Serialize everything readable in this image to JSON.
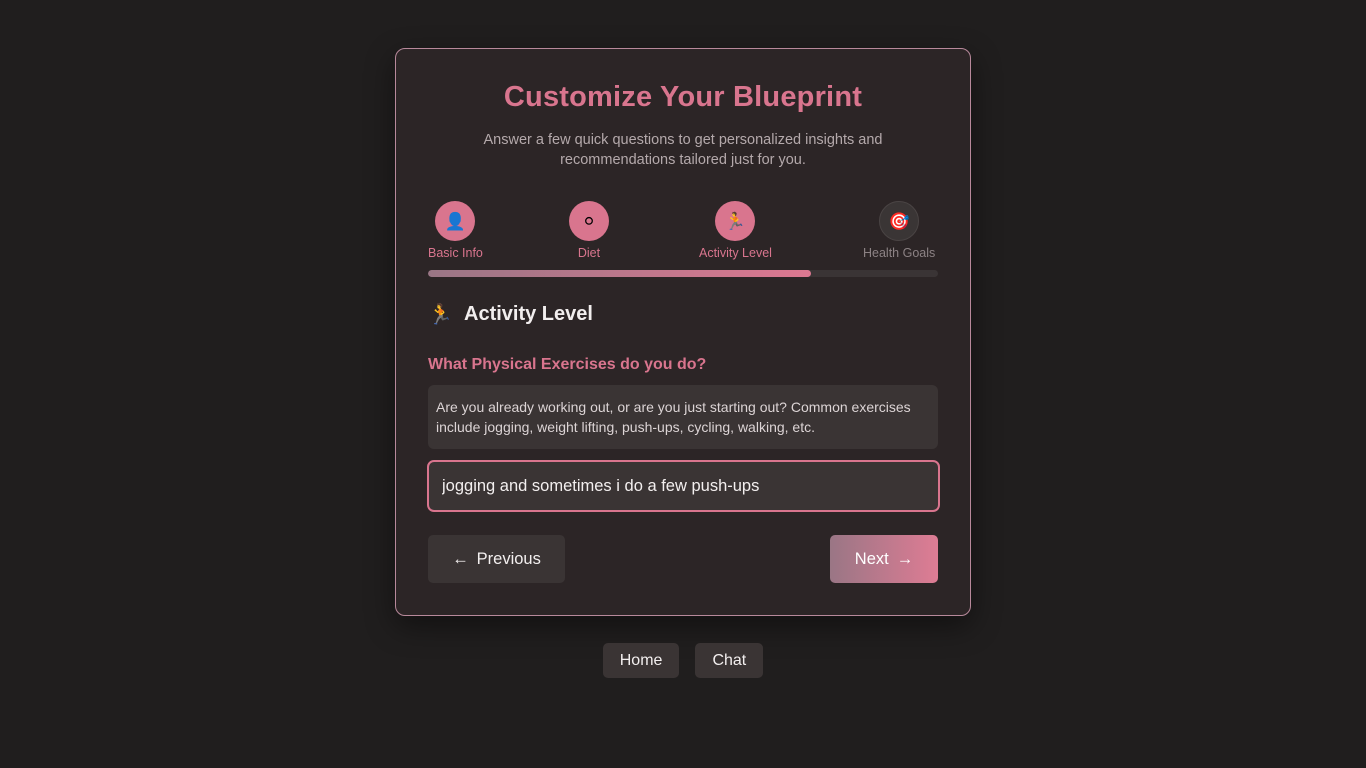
{
  "header": {
    "title": "Customize Your Blueprint",
    "subtitle": "Answer a few quick questions to get personalized insights and recommendations tailored just for you."
  },
  "steps": [
    {
      "label": "Basic Info",
      "icon": "person-silhouette-icon",
      "glyph": "👤",
      "state": "done"
    },
    {
      "label": "Diet",
      "icon": "diet-icon",
      "glyph": "⚪",
      "state": "done"
    },
    {
      "label": "Activity Level",
      "icon": "runner-icon",
      "glyph": "🏃",
      "state": "active"
    },
    {
      "label": "Health Goals",
      "icon": "target-icon",
      "glyph": "🎯",
      "state": "pending"
    }
  ],
  "progress": {
    "fraction": 0.75
  },
  "section": {
    "icon": "runner-icon",
    "glyph": "🏃",
    "title": "Activity Level"
  },
  "form": {
    "question": "What Physical Exercises do you do?",
    "hint": "Are you already working out, or are you just starting out? Common exercises include jogging, weight lifting, push-ups, cycling, walking, etc.",
    "answer_value": "jogging and sometimes i do a few push-ups"
  },
  "buttons": {
    "previous_arrow": "←",
    "previous_label": "Previous",
    "next_label": "Next",
    "next_arrow": "→"
  },
  "footer_nav": {
    "home": "Home",
    "chat": "Chat"
  },
  "colors": {
    "accent": "#d9758e",
    "background": "#201e1e",
    "card": "#2c2526",
    "input_bg": "#3a3434"
  }
}
